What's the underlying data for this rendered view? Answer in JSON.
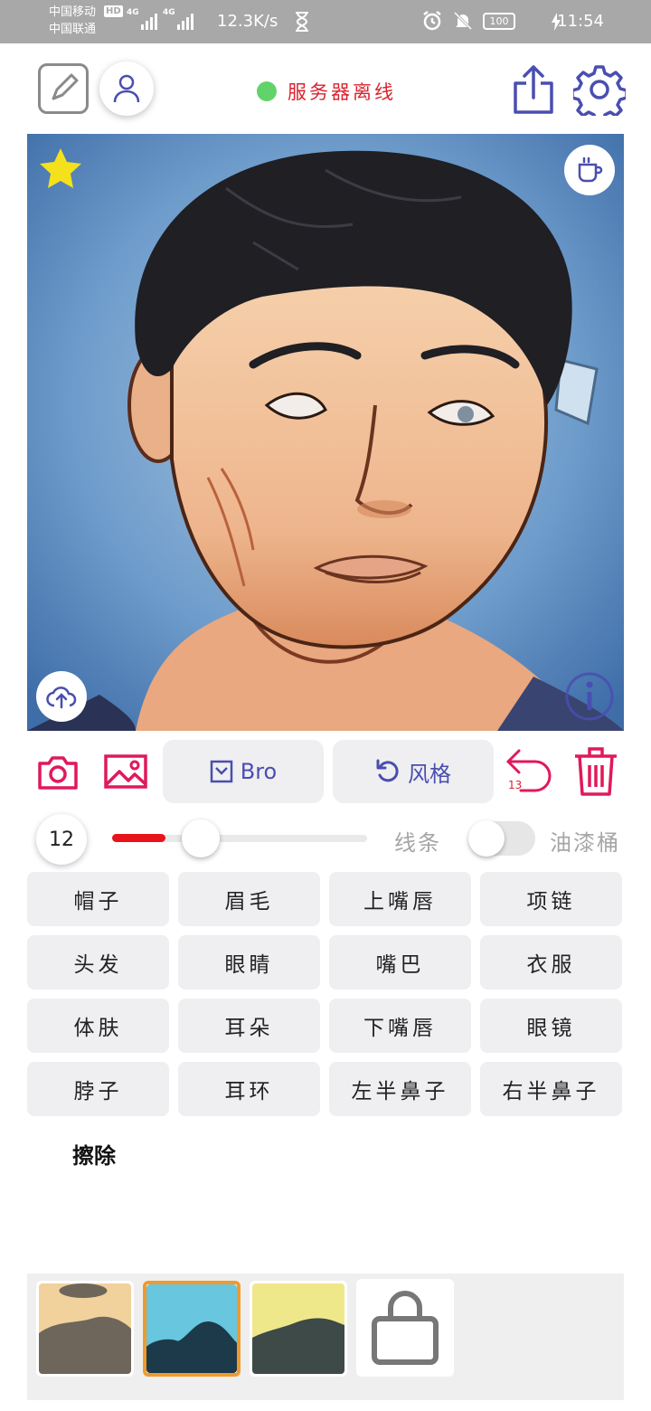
{
  "status_bar": {
    "carrier_1": "中国移动",
    "carrier_2": "中国联通",
    "hd_badge": "HD",
    "network_1": "4G",
    "network_2": "4G",
    "speed": "12.3K/s",
    "battery": "100",
    "time": "11:54"
  },
  "header": {
    "server_status": "服务器离线",
    "server_status_color": "#62d36a"
  },
  "toolbar": {
    "bro_label": "Bro",
    "style_label": "风格",
    "undo_count": "13"
  },
  "brush": {
    "size": "12",
    "slider_fraction": 0.21,
    "line_label": "线条",
    "bucket_label": "油漆桶",
    "bucket_enabled": false
  },
  "parts": [
    "帽子",
    "眉毛",
    "上嘴唇",
    "项链",
    "头发",
    "眼睛",
    "嘴巴",
    "衣服",
    "体肤",
    "耳朵",
    "下嘴唇",
    "眼镜",
    "脖子",
    "耳环",
    "左半鼻子",
    "右半鼻子"
  ],
  "erase_label": "擦除",
  "colors": {
    "accent_blue": "#4a4eb0",
    "accent_red": "#d9232f",
    "slider_red": "#e8141c",
    "selected_border": "#f09a2c"
  },
  "thumbnails": [
    {
      "bg_top": "#f4d9a4",
      "bg_bottom": "#e6c07e",
      "shape": "#6e665a",
      "selected": false
    },
    {
      "bg_top": "#7fd4e6",
      "bg_bottom": "#4fb9d6",
      "shape": "#1c3a4a",
      "selected": true
    },
    {
      "bg_top": "#f4ee96",
      "bg_bottom": "#e2e07e",
      "shape": "#3e4a48",
      "selected": false
    }
  ]
}
